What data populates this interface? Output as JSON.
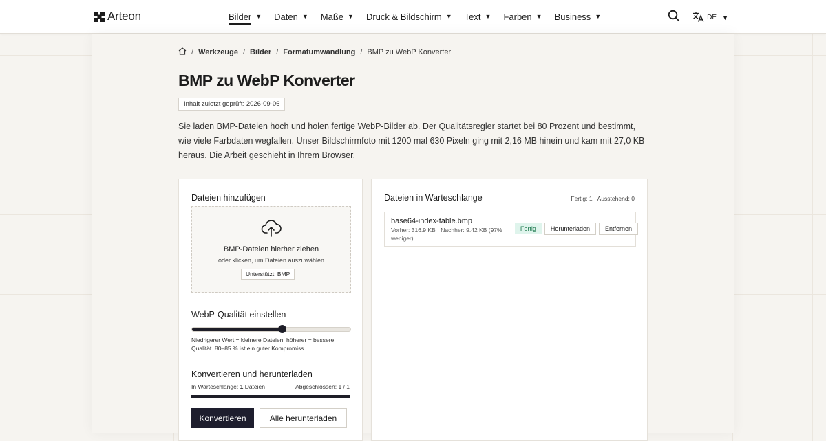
{
  "header": {
    "brand": "Arteon",
    "nav": [
      {
        "label": "Bilder",
        "active": true
      },
      {
        "label": "Daten"
      },
      {
        "label": "Maße"
      },
      {
        "label": "Druck & Bildschirm"
      },
      {
        "label": "Text"
      },
      {
        "label": "Farben"
      },
      {
        "label": "Business"
      }
    ],
    "language": "DE",
    "search_icon": "search-icon",
    "translate_icon": "translate-icon"
  },
  "breadcrumb": {
    "items": [
      "Werkzeuge",
      "Bilder",
      "Formatumwandlung"
    ],
    "current": "BMP zu WebP Konverter",
    "home_icon": "home-icon"
  },
  "page": {
    "title": "BMP zu WebP Konverter",
    "review_badge": "Inhalt zuletzt geprüft: 2026-09-06",
    "intro": "Sie laden BMP-Dateien hoch und holen fertige WebP-Bilder ab. Der Qualitätsregler startet bei 80 Prozent und bestimmt, wie viele Farbdaten wegfallen. Unser Bildschirmfoto mit 1200 mal 630 Pixeln ging mit 2,16 MB hinein und kam mit 27,0 KB heraus. Die Arbeit geschieht in Ihrem Browser."
  },
  "upload": {
    "title": "Dateien hinzufügen",
    "dropzone_title": "BMP-Dateien hierher ziehen",
    "dropzone_sub": "oder klicken, um Dateien auszuwählen",
    "supported": "Unterstützt: BMP",
    "upload_icon": "cloud-upload-icon"
  },
  "quality": {
    "title": "WebP-Qualität einstellen",
    "value": 0.57,
    "hint": "Niedrigerer Wert = kleinere Dateien, höherer = bessere Qualität. 80–85 % ist ein guter Kompromiss."
  },
  "convert": {
    "title": "Konvertieren und herunterladen",
    "queue_prefix": "In Warteschlange:",
    "queue_count": "1",
    "queue_unit": "Dateien",
    "completed": "Abgeschlossen: 1 / 1",
    "progress": 1.0,
    "convert_label": "Konvertieren",
    "download_all_label": "Alle herunterladen"
  },
  "queue": {
    "title": "Dateien in Warteschlange",
    "summary": "Fertig: 1 · Ausstehend: 0",
    "files": [
      {
        "name": "base64-index-table.bmp",
        "meta": "Vorher: 316.9 KB · Nachher: 9.42 KB (97% weniger)",
        "status": "Fertig",
        "download_label": "Herunterladen",
        "remove_label": "Entfernen"
      }
    ]
  },
  "colors": {
    "accent": "#1e1e2e",
    "status_done_bg": "#dff4ec",
    "status_done_text": "#1f7a4f",
    "page_bg": "#f6f4f0"
  }
}
